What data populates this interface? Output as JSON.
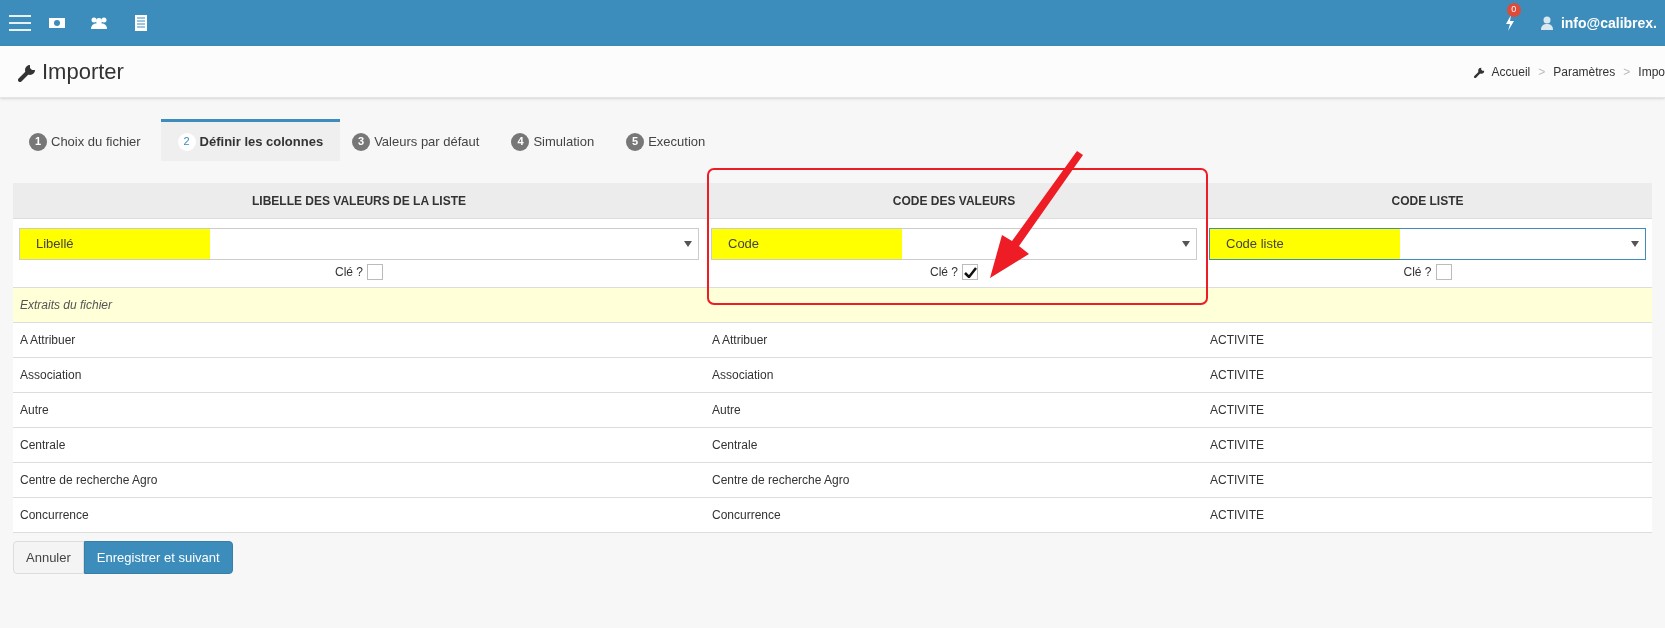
{
  "top_bar": {
    "notification_count": "0",
    "user": "info@calibrex."
  },
  "page": {
    "title": "Importer",
    "breadcrumb": [
      "Accueil",
      "Paramètres",
      "Impo"
    ],
    "breadcrumb_separator": ">"
  },
  "tabs": [
    {
      "number": "1",
      "label": "Choix du fichier",
      "selected": false
    },
    {
      "number": "2",
      "label": "Définir les colonnes",
      "selected": true
    },
    {
      "number": "3",
      "label": "Valeurs par défaut",
      "selected": false
    },
    {
      "number": "4",
      "label": "Simulation",
      "selected": false
    },
    {
      "number": "5",
      "label": "Execution",
      "selected": false
    }
  ],
  "table": {
    "columns": [
      {
        "heading": "LIBELLE DES VALEURS DE LA LISTE",
        "select": "Libellé",
        "key_label": "Clé ?",
        "key_checked": false,
        "highlighted": true,
        "focused": false
      },
      {
        "heading": "CODE DES VALEURS",
        "select": "Code",
        "key_label": "Clé ?",
        "key_checked": true,
        "highlighted": true,
        "focused": false
      },
      {
        "heading": "CODE LISTE",
        "select": "Code liste",
        "key_label": "Clé ?",
        "key_checked": false,
        "highlighted": true,
        "focused": true
      }
    ],
    "extract_label": "Extraits du fichier",
    "rows": [
      [
        "A Attribuer",
        "A Attribuer",
        "ACTIVITE"
      ],
      [
        "Association",
        "Association",
        "ACTIVITE"
      ],
      [
        "Autre",
        "Autre",
        "ACTIVITE"
      ],
      [
        "Centrale",
        "Centrale",
        "ACTIVITE"
      ],
      [
        "Centre de recherche Agro",
        "Centre de recherche Agro",
        "ACTIVITE"
      ],
      [
        "Concurrence",
        "Concurrence",
        "ACTIVITE"
      ]
    ]
  },
  "buttons": [
    {
      "label": "Annuler",
      "kind": "default"
    },
    {
      "label": "Enregistrer et suivant",
      "kind": "primary"
    }
  ]
}
